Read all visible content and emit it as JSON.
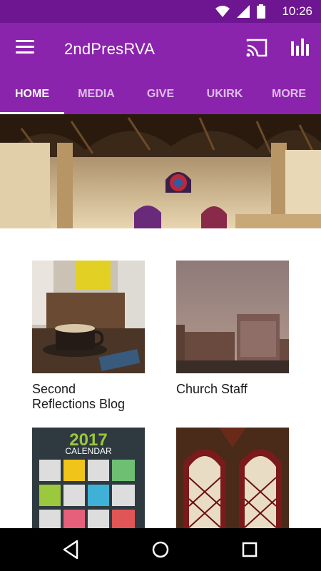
{
  "status_bar": {
    "time": "10:26",
    "icons": [
      "wifi-icon",
      "signal-icon",
      "battery-icon"
    ]
  },
  "app_bar": {
    "title": "2ndPresRVA",
    "menu_icon": "hamburger-menu-icon",
    "cast_icon": "cast-icon",
    "stats_icon": "bar-chart-icon"
  },
  "tabs": [
    {
      "label": "HOME",
      "active": true
    },
    {
      "label": "MEDIA",
      "active": false
    },
    {
      "label": "GIVE",
      "active": false
    },
    {
      "label": "UKIRK",
      "active": false
    },
    {
      "label": "MORE",
      "active": false
    }
  ],
  "grid": [
    {
      "caption_line1": "Second",
      "caption_line2": "Reflections Blog"
    },
    {
      "caption_line1": "Church Staff",
      "caption_line2": ""
    },
    {
      "calendar_year": "2017",
      "calendar_label": "CALENDAR"
    },
    {}
  ],
  "nav_bar": {
    "buttons": [
      "back-icon",
      "home-icon",
      "recents-icon"
    ]
  },
  "colors": {
    "status_bar": "#6e1591",
    "app_bar": "#8b24ad",
    "background": "#ffffff",
    "nav_bar": "#000000"
  }
}
